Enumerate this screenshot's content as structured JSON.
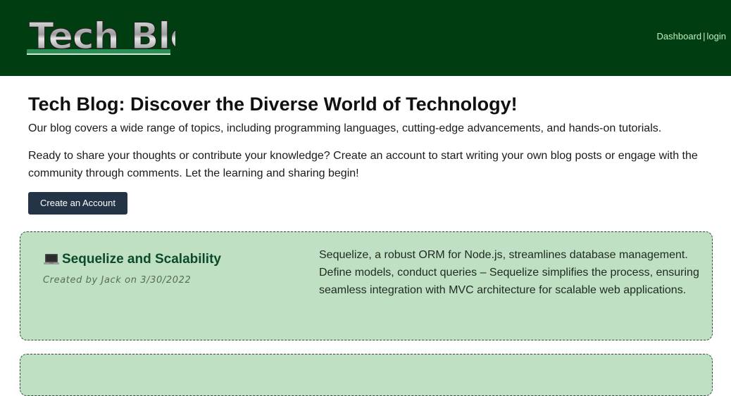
{
  "header": {
    "logo_text": "Tech Blog",
    "nav": {
      "dashboard": "Dashboard",
      "separator": "|",
      "login": "login"
    }
  },
  "intro": {
    "title": "Tech Blog: Discover the Diverse World of Technology!",
    "paragraph_1": "Our blog covers a wide range of topics, including programming languages, cutting-edge advancements, and hands-on tutorials.",
    "paragraph_2": "Ready to share your thoughts or contribute your knowledge? Create an account to start writing your own blog posts or engage with the community through comments. Let the learning and sharing begin!",
    "create_account_label": "Create an Account"
  },
  "posts": [
    {
      "icon": "laptop-icon",
      "title": "Sequelize and Scalability",
      "meta": "Created by Jack on 3/30/2022",
      "body": "Sequelize, a robust ORM for Node.js, streamlines database management. Define models, conduct queries – Sequelize simplifies the process, ensuring seamless integration with MVC architecture for scalable web applications."
    }
  ],
  "colors": {
    "header_bg": "#003d10",
    "card_bg": "#bfe0c3",
    "button_bg": "#233446",
    "post_title": "#0b4a2b"
  }
}
